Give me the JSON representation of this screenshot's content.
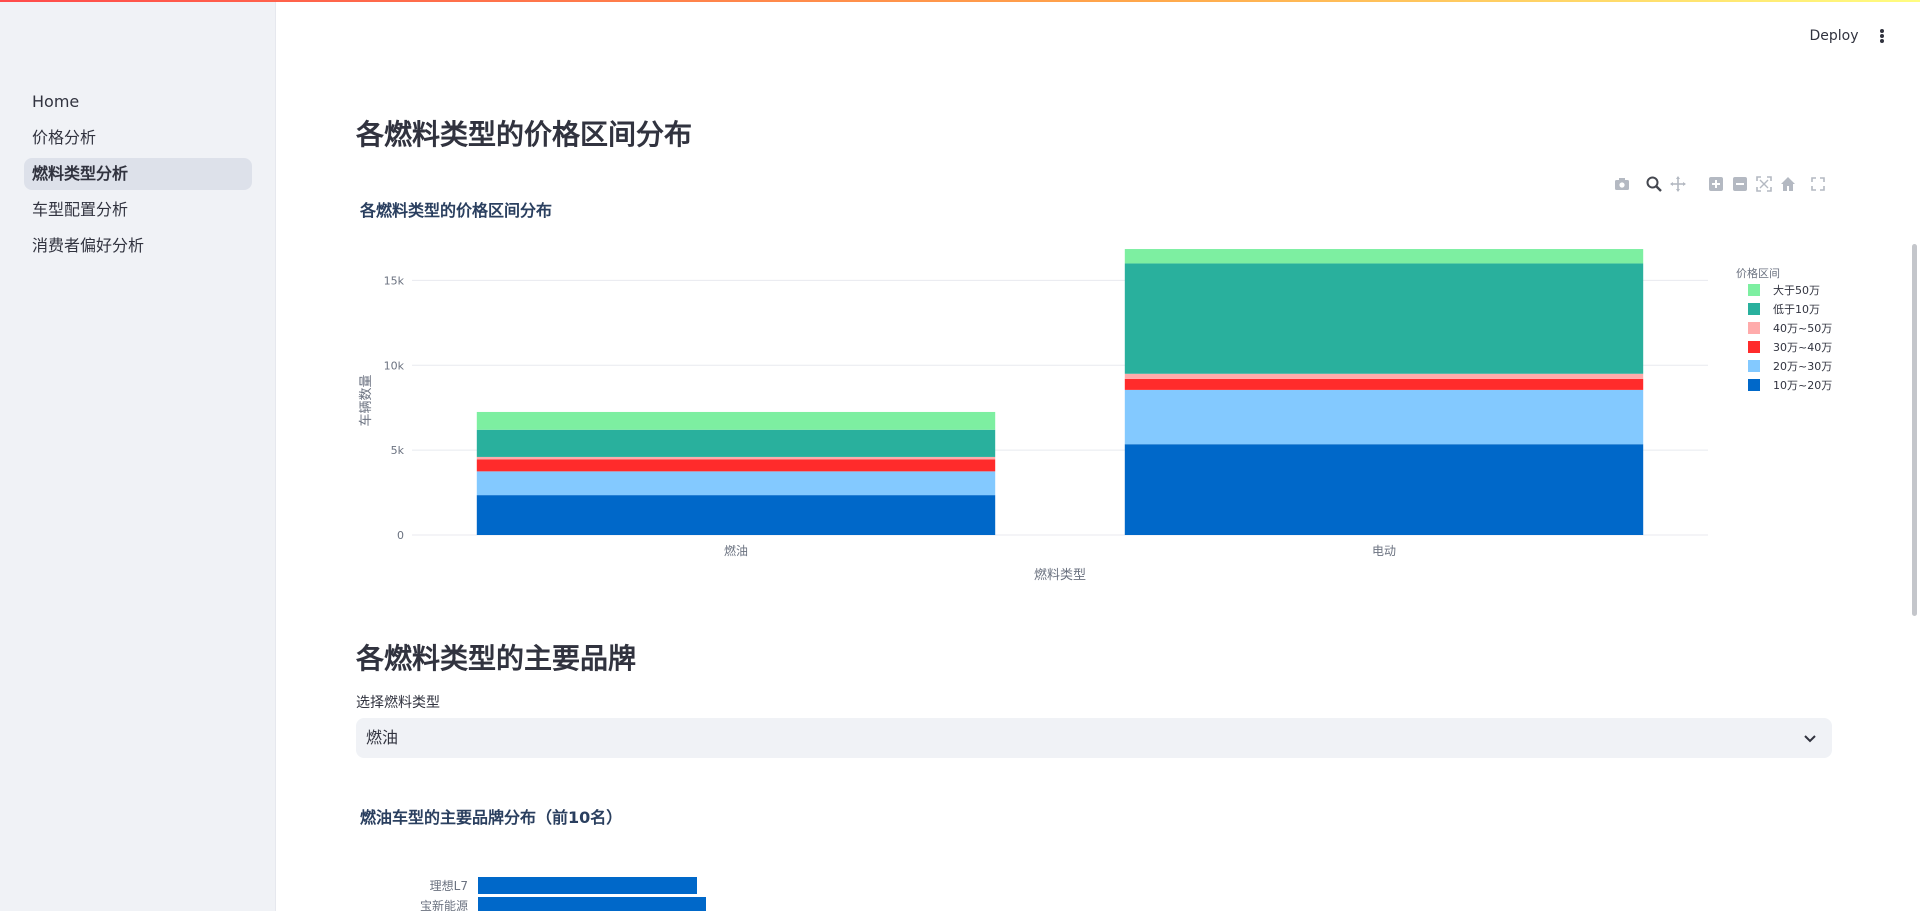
{
  "sidebar": {
    "items": [
      {
        "label": "Home",
        "active": false
      },
      {
        "label": "价格分析",
        "active": false
      },
      {
        "label": "燃料类型分析",
        "active": true
      },
      {
        "label": "车型配置分析",
        "active": false
      },
      {
        "label": "消费者偏好分析",
        "active": false
      }
    ]
  },
  "header": {
    "deploy_label": "Deploy"
  },
  "section1": {
    "title": "各燃料类型的价格区间分布"
  },
  "section2": {
    "title": "各燃料类型的主要品牌",
    "select_label": "选择燃料类型",
    "select_value": "燃油"
  },
  "modebar_icons": [
    "camera-icon",
    "zoom-icon",
    "pan-icon",
    "zoom-in-icon",
    "zoom-out-icon",
    "autoscale-icon",
    "reset-axes-icon",
    "fullscreen-icon"
  ],
  "colors": {
    "accent_gradient": [
      "#ff4b4b",
      "#ffa84b",
      "#fffd80"
    ],
    "sidebar_bg": "#f0f2f6",
    "active_nav_bg": "#dde1ea"
  },
  "chart_data": [
    {
      "type": "bar",
      "stacked": true,
      "title": "各燃料类型的价格区间分布",
      "xlabel": "燃料类型",
      "ylabel": "车辆数量",
      "categories": [
        "燃油",
        "电动"
      ],
      "yticks": [
        0,
        5000,
        10000,
        15000
      ],
      "ytick_labels": [
        "0",
        "5k",
        "10k",
        "15k"
      ],
      "ylim": [
        0,
        17500
      ],
      "legend_title": "价格区间",
      "legend_position": "right",
      "grid": true,
      "series": [
        {
          "name": "10万~20万",
          "color": "#0068c9",
          "values": [
            2350,
            5350
          ]
        },
        {
          "name": "20万~30万",
          "color": "#83c9ff",
          "values": [
            1400,
            3200
          ]
        },
        {
          "name": "30万~40万",
          "color": "#ff2b2b",
          "values": [
            700,
            650
          ]
        },
        {
          "name": "40万~50万",
          "color": "#ffabab",
          "values": [
            150,
            300
          ]
        },
        {
          "name": "低于10万",
          "color": "#29b09d",
          "values": [
            1600,
            6500
          ]
        },
        {
          "name": "大于50万",
          "color": "#7defa1",
          "values": [
            1050,
            850
          ]
        }
      ],
      "legend_order": [
        "大于50万",
        "低于10万",
        "40万~50万",
        "30万~40万",
        "20万~30万",
        "10万~20万"
      ]
    },
    {
      "type": "bar",
      "orientation": "horizontal",
      "title": "燃油车型的主要品牌分布（前10名）",
      "categories": [
        "理想L7",
        "宝新能源"
      ],
      "values": [
        730,
        760
      ],
      "color": "#0068c9"
    }
  ]
}
